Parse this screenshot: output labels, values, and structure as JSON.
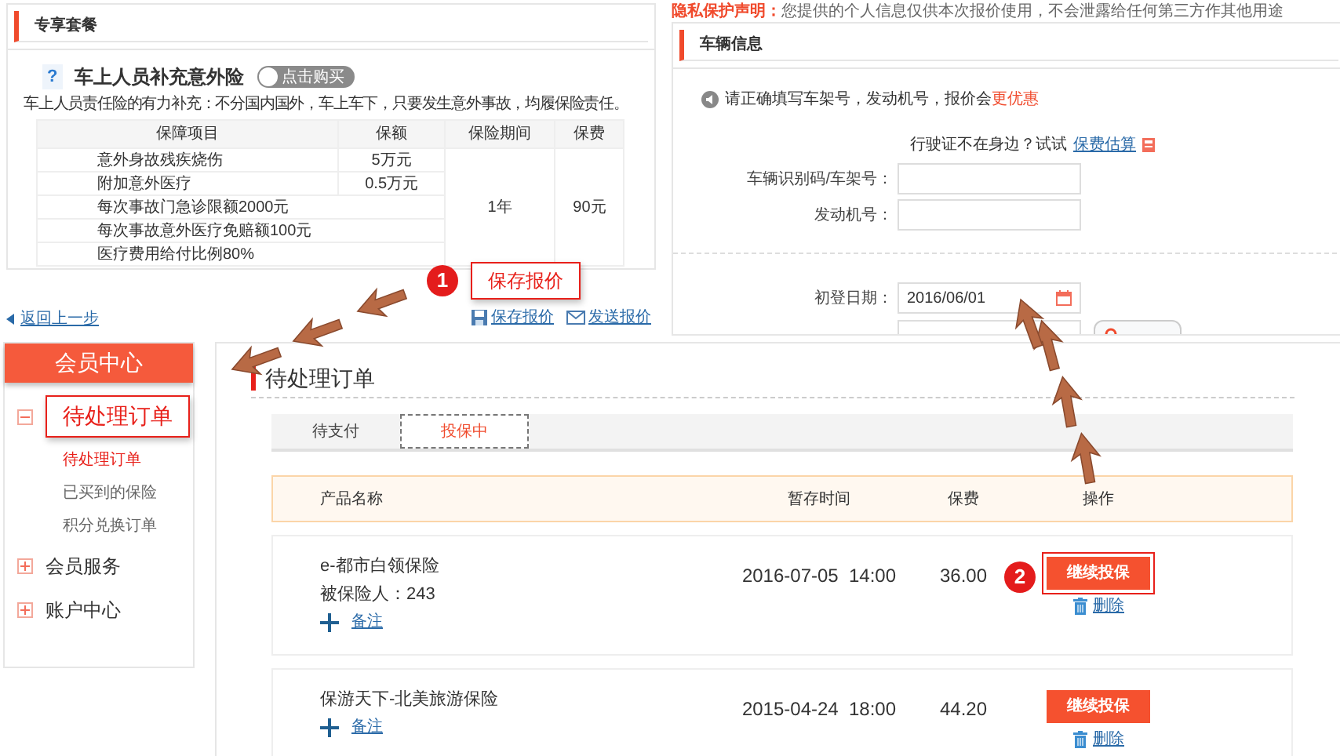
{
  "package_panel": {
    "title": "专享套餐",
    "help_icon": "?",
    "product": "车上人员补充意外险",
    "buy_toggle": {
      "label": "点击购买",
      "on": false
    },
    "description": "车上人员责任险的有力补充：不分国内国外，车上车下，只要发生意外事故，均履保险责任。",
    "table": {
      "columns": [
        "保障项目",
        "保额",
        "保险期间",
        "保费"
      ],
      "period": "1年",
      "premium": "90元",
      "rows": [
        {
          "item": "意外身故残疾烧伤",
          "amount": "5万元"
        },
        {
          "item": "附加意外医疗",
          "amount": "0.5万元"
        },
        {
          "item": "每次事故门急诊限额2000元"
        },
        {
          "item": "每次事故意外医疗免赔额100元"
        },
        {
          "item": "医疗费用给付比例80%"
        }
      ]
    }
  },
  "back_link": "返回上一步",
  "quote_actions": [
    {
      "kind": "save",
      "label": "保存报价"
    },
    {
      "kind": "send",
      "label": "发送报价"
    }
  ],
  "privacy": {
    "label": "隐私保护声明：",
    "text": "您提供的个人信息仅供本次报价使用，不会泄露给任何第三方作其他用途"
  },
  "vehicle_panel": {
    "title": "车辆信息",
    "notice": {
      "text": "请正确填写车架号，发动机号，报价会",
      "emphasis": "更优惠"
    },
    "hint": "行驶证不在身边？试试",
    "hint_link": "保费估算",
    "fields": [
      {
        "kind": "text",
        "label": "车辆识别码/车架号："
      },
      {
        "kind": "text",
        "label": "发动机号："
      },
      {
        "kind": "divider"
      },
      {
        "kind": "date",
        "label": "初登日期：",
        "value": "2016/06/01"
      },
      {
        "kind": "search"
      }
    ]
  },
  "sidebar": {
    "title": "会员中心",
    "groups": [
      {
        "label": "待处理订单",
        "expanded": true,
        "highlighted": true,
        "children": [
          {
            "label": "待处理订单",
            "selected": true
          },
          {
            "label": "已买到的保险",
            "selected": false
          },
          {
            "label": "积分兑换订单",
            "selected": false
          }
        ]
      },
      {
        "label": "会员服务",
        "expanded": false,
        "highlighted": false
      },
      {
        "label": "账户中心",
        "expanded": false,
        "highlighted": false
      }
    ]
  },
  "orders": {
    "title": "待处理订单",
    "tabs": [
      {
        "label": "待支付",
        "selected": false
      },
      {
        "label": "投保中",
        "selected": true
      }
    ],
    "columns": [
      "产品名称",
      "暂存时间",
      "保费",
      "操作"
    ],
    "rows": [
      {
        "name": "e-都市白领保险",
        "insured": "被保险人：243",
        "note": "备注",
        "time": "2016-07-05  14:00",
        "premium": "36.00",
        "action": "继续投保",
        "delete": "删除",
        "highlighted": true,
        "step": "2"
      },
      {
        "name": "保游天下-北美旅游保险",
        "note": "备注",
        "time": "2015-04-24  18:00",
        "premium": "44.20",
        "action": "继续投保",
        "delete": "删除",
        "highlighted": false
      }
    ]
  },
  "callout": {
    "step": "1",
    "label": "保存报价"
  }
}
